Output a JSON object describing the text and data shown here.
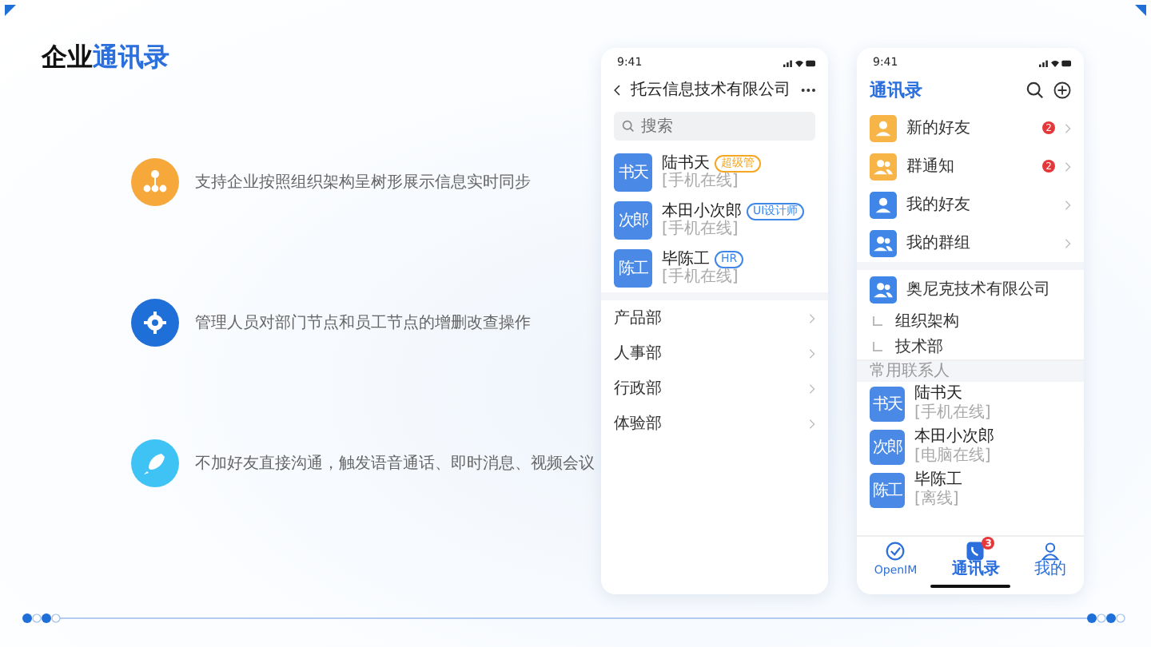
{
  "title": {
    "plain": "企业",
    "accent": "通讯录"
  },
  "features": [
    {
      "kind": "org",
      "color": "#f7a83a",
      "text": "支持企业按照组织架构呈树形展示信息实时同步"
    },
    {
      "kind": "gear",
      "color": "#1f6fd8",
      "text": "管理人员对部门节点和员工节点的增删改查操作"
    },
    {
      "kind": "rocket",
      "color": "#3fc3f5",
      "text": "不加好友直接沟通，触发语音通话、即时消息、视频会议"
    }
  ],
  "phone_left": {
    "time": "9:41",
    "title": "托云信息技术有限公司",
    "search": {
      "placeholder": "搜索"
    },
    "members": [
      {
        "avatar": "书天",
        "name": "陆书天",
        "tag": "超级管",
        "color": "#f5a623",
        "status": "[手机在线]"
      },
      {
        "avatar": "次郎",
        "name": "本田小次郎",
        "tag": "UI设计师",
        "color": "#3f86e8",
        "status": "[手机在线]"
      },
      {
        "avatar": "陈工",
        "name": "毕陈工",
        "tag": "HR",
        "color": "#3f86e8",
        "status": "[手机在线]"
      }
    ],
    "departments": [
      "产品部",
      "人事部",
      "行政部",
      "体验部"
    ]
  },
  "phone_right": {
    "time": "9:41",
    "title": "通讯录",
    "entries": [
      {
        "label": "新的好友",
        "kind": "person",
        "color": "#f7b548",
        "badge": "2"
      },
      {
        "label": "群通知",
        "kind": "group",
        "color": "#f7b548",
        "badge": "2"
      },
      {
        "label": "我的好友",
        "kind": "person",
        "color": "#3f86e8"
      },
      {
        "label": "我的群组",
        "kind": "group",
        "color": "#3f86e8"
      }
    ],
    "organization": {
      "name": "奥尼克技术有限公司",
      "children": [
        {
          "name": "组织架构"
        },
        {
          "name": "技术部"
        }
      ]
    },
    "section": "常用联系人",
    "contacts": [
      {
        "avatar": "书天",
        "name": "陆书天",
        "status": "[手机在线]"
      },
      {
        "avatar": "次郎",
        "name": "本田小次郎",
        "status": "[电脑在线]"
      },
      {
        "avatar": "陈工",
        "name": "毕陈工",
        "status": "[离线]"
      }
    ],
    "tabs": [
      {
        "label": "OpenIM",
        "kind": "home",
        "selected": false
      },
      {
        "label": "通讯录",
        "kind": "contacts",
        "selected": true,
        "badge": "3"
      },
      {
        "label": "我的",
        "kind": "profile",
        "selected": false
      }
    ]
  }
}
